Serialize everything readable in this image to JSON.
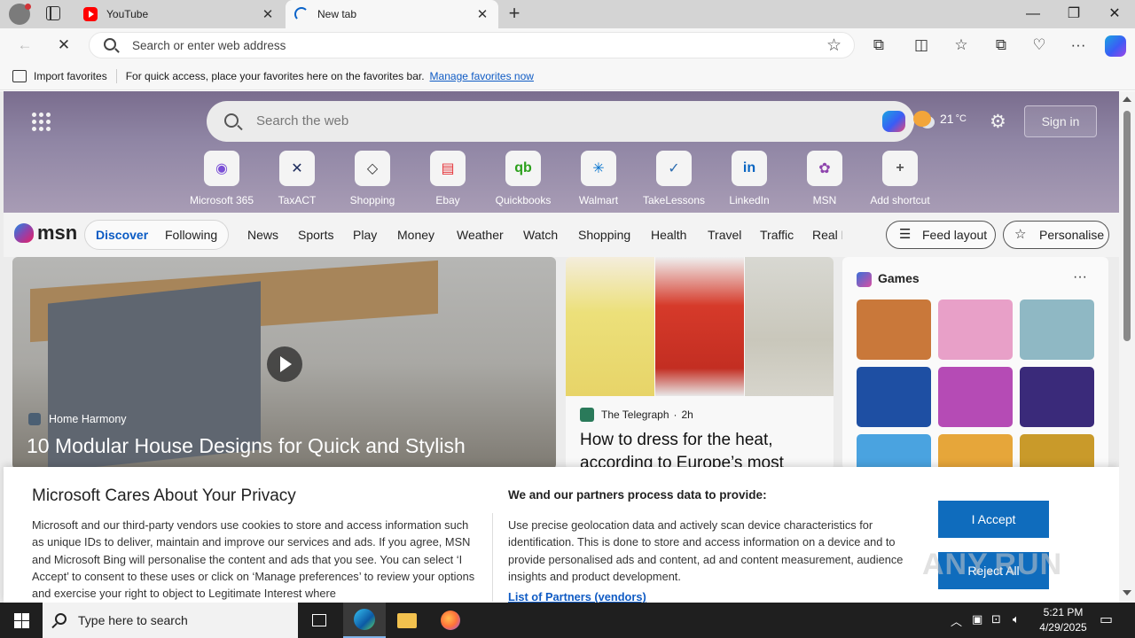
{
  "browser": {
    "tabs": [
      {
        "title": "YouTube",
        "icon": "youtube-icon",
        "active": false
      },
      {
        "title": "New tab",
        "icon": "loading-spinner-icon",
        "active": true
      }
    ],
    "address_placeholder": "Search or enter web address",
    "favorites_bar": {
      "import_label": "Import favorites",
      "hint": "For quick access, place your favorites here on the favorites bar.",
      "manage_link": "Manage favorites now"
    }
  },
  "msn": {
    "search_placeholder": "Search the web",
    "temperature": "21",
    "temperature_unit": "°C",
    "sign_in": "Sign in",
    "shortcuts": [
      {
        "label": "Microsoft 365",
        "icon": "m365-icon",
        "color": "#7a4fd6"
      },
      {
        "label": "TaxACT",
        "icon": "taxact-icon",
        "color": "#1c2a5c"
      },
      {
        "label": "Shopping",
        "icon": "shopping-tag-icon",
        "color": "#333333"
      },
      {
        "label": "Ebay",
        "icon": "ebay-icon",
        "color": "#e53238"
      },
      {
        "label": "Quickbooks",
        "icon": "quickbooks-icon",
        "color": "#2ca01c"
      },
      {
        "label": "Walmart",
        "icon": "walmart-icon",
        "color": "#0071ce"
      },
      {
        "label": "TakeLessons",
        "icon": "takelessons-icon",
        "color": "#2b6cb0"
      },
      {
        "label": "LinkedIn",
        "icon": "linkedin-icon",
        "color": "#0a66c2"
      },
      {
        "label": "MSN",
        "icon": "msn-icon",
        "color": "#8e44ad"
      },
      {
        "label": "Add shortcut",
        "icon": "plus-icon",
        "color": "#555555"
      }
    ],
    "logo_text": "msn",
    "nav_toggle": {
      "discover": "Discover",
      "following": "Following"
    },
    "nav_links": [
      "News",
      "Sports",
      "Play",
      "Money",
      "Weather",
      "Watch",
      "Shopping",
      "Health",
      "Travel",
      "Traffic",
      "Real E"
    ],
    "feed_layout": "Feed layout",
    "personalise": "Personalise",
    "hero": {
      "source": "Home Harmony",
      "headline": "10 Modular House Designs for Quick and Stylish"
    },
    "fashion": {
      "source": "The Telegraph",
      "age": "2h",
      "headline": "How to dress for the heat, according to Europe’s most"
    },
    "games": {
      "title": "Games",
      "more": "···",
      "tiles": [
        {
          "name": "game-tile-1",
          "color": "#c9783a"
        },
        {
          "name": "game-tile-2",
          "color": "#e8a0c8"
        },
        {
          "name": "game-tile-3",
          "color": "#8fb8c4"
        },
        {
          "name": "game-tile-blocks",
          "color": "#1e4fa3"
        },
        {
          "name": "game-tile-makeup",
          "color": "#b54bb5"
        },
        {
          "name": "game-tile-bubble-shooter",
          "color": "#3a2a7a"
        },
        {
          "name": "game-tile-7",
          "color": "#4aa3e0"
        },
        {
          "name": "game-tile-8",
          "color": "#e6a63a"
        },
        {
          "name": "game-tile-9",
          "color": "#c99a2a"
        }
      ]
    }
  },
  "privacy": {
    "title": "Microsoft Cares About Your Privacy",
    "body": "Microsoft and our third-party vendors use cookies to store and access information such as unique IDs to deliver, maintain and improve our services and ads. If you agree, MSN and Microsoft Bing will personalise the content and ads that you see. You can select ‘I Accept’ to consent to these uses or click on ‘Manage preferences’ to review your options and exercise your right to object to Legitimate Interest where",
    "subtitle": "We and our partners process data to provide:",
    "purposes": "Use precise geolocation data and actively scan device characteristics for identification. This is done to store and access information on a device and to provide personalised ads and content, ad and content measurement, audience insights and product development.",
    "partners_link": "List of Partners (vendors)",
    "accept": "I Accept",
    "reject": "Reject All"
  },
  "watermark": "ANY.RUN",
  "taskbar": {
    "search_placeholder": "Type here to search",
    "time": "5:21 PM",
    "date": "4/29/2025"
  }
}
